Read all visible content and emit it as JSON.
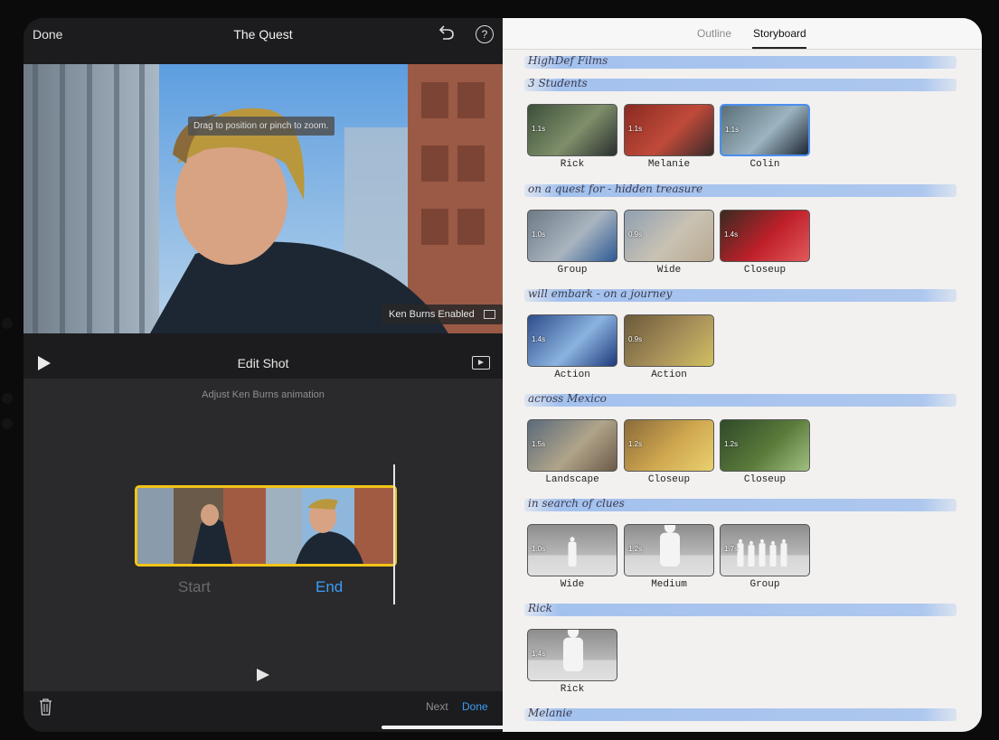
{
  "toolbar": {
    "done": "Done",
    "title": "The Quest"
  },
  "viewer": {
    "hint": "Drag to position or pinch to zoom.",
    "ken_burns_badge": "Ken Burns Enabled"
  },
  "edit_shot": {
    "title": "Edit Shot",
    "adjust_text": "Adjust Ken Burns animation",
    "start_label": "Start",
    "end_label": "End"
  },
  "bottom": {
    "next": "Next",
    "done": "Done"
  },
  "tabs": {
    "outline": "Outline",
    "storyboard": "Storyboard",
    "active": "Storyboard"
  },
  "storyboard": {
    "sections": [
      {
        "title": "HighDef Films",
        "clips": []
      },
      {
        "title": "3 Students",
        "clips": [
          {
            "duration": "1.1s",
            "label": "Rick",
            "selected": false
          },
          {
            "duration": "1.1s",
            "label": "Melanie",
            "selected": false
          },
          {
            "duration": "1.1s",
            "label": "Colin",
            "selected": true
          }
        ]
      },
      {
        "title": "on a quest for - hidden treasure",
        "clips": [
          {
            "duration": "1.0s",
            "label": "Group"
          },
          {
            "duration": "0.9s",
            "label": "Wide"
          },
          {
            "duration": "1.4s",
            "label": "Closeup"
          }
        ]
      },
      {
        "title": "will embark - on a journey",
        "clips": [
          {
            "duration": "1.4s",
            "label": "Action"
          },
          {
            "duration": "0.9s",
            "label": "Action"
          }
        ]
      },
      {
        "title": "across Mexico",
        "clips": [
          {
            "duration": "1.5s",
            "label": "Landscape"
          },
          {
            "duration": "1.2s",
            "label": "Closeup"
          },
          {
            "duration": "1.2s",
            "label": "Closeup"
          }
        ]
      },
      {
        "title": "in search of clues",
        "clips": [
          {
            "duration": "1.0s",
            "label": "Wide",
            "placeholder": "wide"
          },
          {
            "duration": "1.2s",
            "label": "Medium",
            "placeholder": "medium"
          },
          {
            "duration": "1.7s",
            "label": "Group",
            "placeholder": "group"
          }
        ]
      },
      {
        "title": "Rick",
        "clips": [
          {
            "duration": "1.4s",
            "label": "Rick",
            "placeholder": "medium"
          }
        ]
      },
      {
        "title": "Melanie",
        "clips": []
      }
    ]
  },
  "colors": {
    "accent": "#3a9df8",
    "selection": "#f2c418",
    "stripe": "#96b9ee"
  },
  "icons": [
    "undo-icon",
    "help-icon",
    "play-icon",
    "fullscreen-icon",
    "trash-icon",
    "ken-burns-icon"
  ]
}
